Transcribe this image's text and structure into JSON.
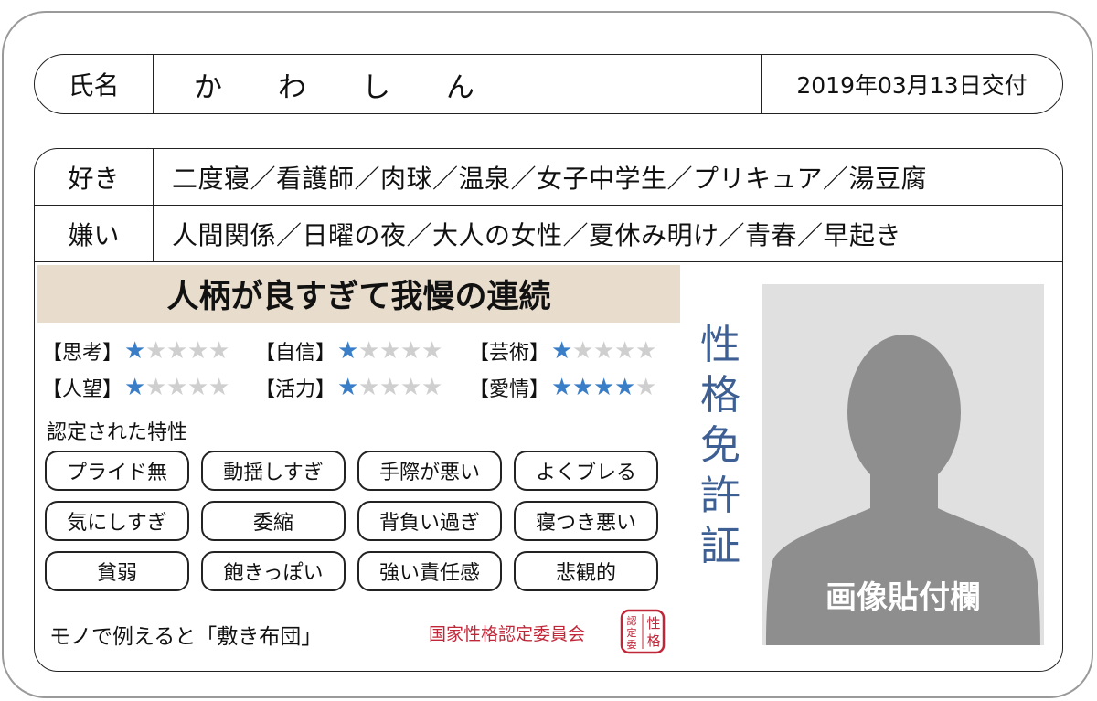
{
  "header": {
    "name_label": "氏名",
    "name_value": "かわしん",
    "issue_date": "2019年03月13日交付"
  },
  "likes": {
    "label": "好き",
    "value": "二度寝／看護師／肉球／温泉／女子中学生／プリキュア／湯豆腐"
  },
  "dislikes": {
    "label": "嫌い",
    "value": "人間関係／日曜の夜／大人の女性／夏休み明け／青春／早起き"
  },
  "headline": "人柄が良すぎて我慢の連続",
  "stats": [
    {
      "label": "【思考】",
      "stars": 1,
      "max": 5
    },
    {
      "label": "【自信】",
      "stars": 1,
      "max": 5
    },
    {
      "label": "【芸術】",
      "stars": 1,
      "max": 5
    },
    {
      "label": "【人望】",
      "stars": 1,
      "max": 5
    },
    {
      "label": "【活力】",
      "stars": 1,
      "max": 5
    },
    {
      "label": "【愛情】",
      "stars": 4,
      "max": 5
    }
  ],
  "traits_title": "認定された特性",
  "traits": [
    "プライド無",
    "動揺しすぎ",
    "手際が悪い",
    "よくブレる",
    "気にしすぎ",
    "委縮",
    "背負い過ぎ",
    "寝つき悪い",
    "貧弱",
    "飽きっぽい",
    "強い責任感",
    "悲観的"
  ],
  "example": "モノで例えると「敷き布団」",
  "committee": "国家性格認定委員会",
  "seal_text": "性格認定委",
  "vertical_title": "性格免許証",
  "photo_label": "画像貼付欄",
  "colors": {
    "star_on": "#3a7ec8",
    "star_off": "#cfcfcf",
    "headline_bg": "#e8dccd",
    "title_blue": "#3e5f93",
    "seal_red": "#c0283a",
    "photo_bg": "#e0e0e0",
    "silhouette": "#8e8e8e"
  }
}
